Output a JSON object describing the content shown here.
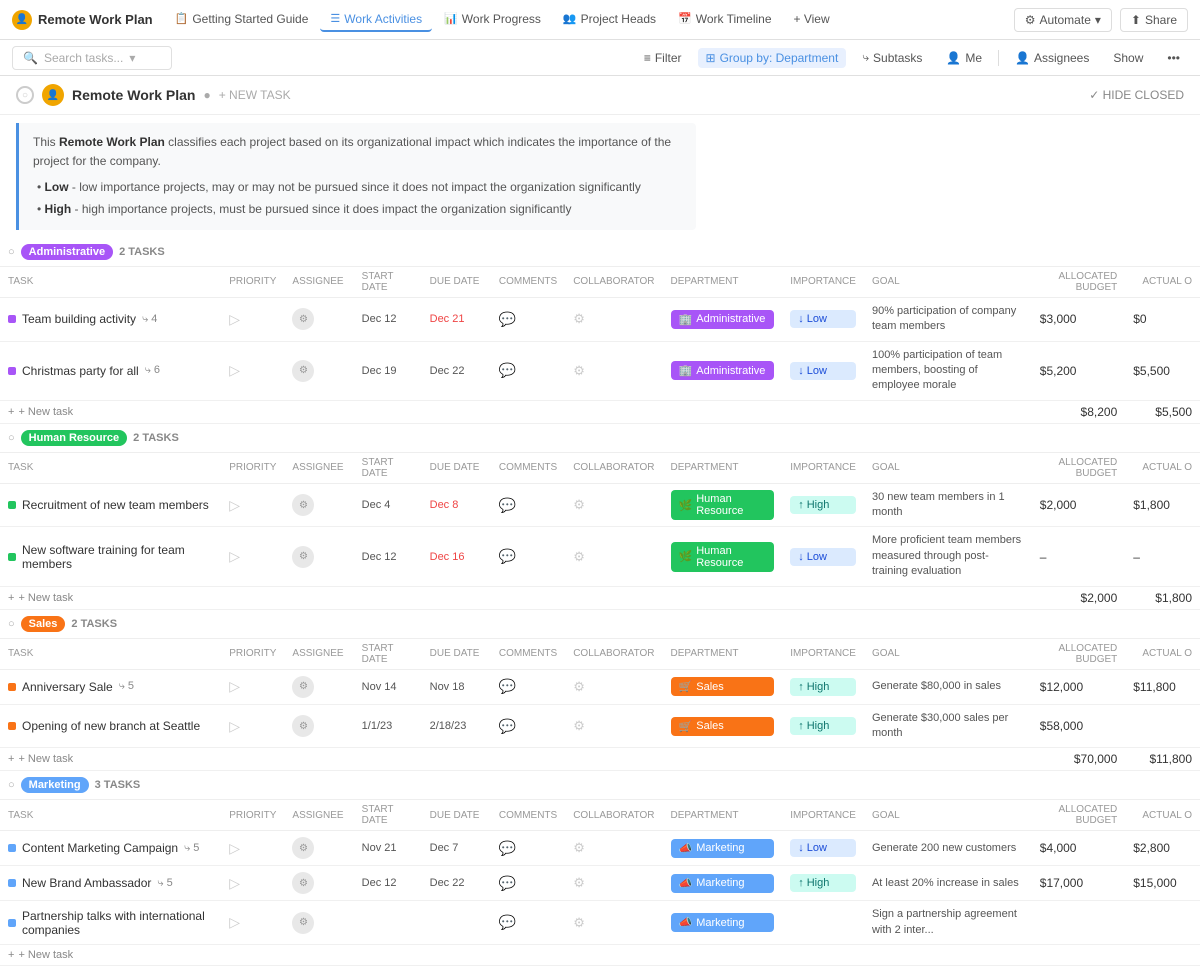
{
  "app": {
    "title": "Remote Work Plan"
  },
  "topnav": {
    "logo_text": "Remote Work Plan",
    "avatar_icon": "👤",
    "tabs": [
      {
        "id": "getting-started",
        "label": "Getting Started Guide",
        "icon": "📋",
        "active": false
      },
      {
        "id": "work-activities",
        "label": "Work Activities",
        "icon": "☰",
        "active": true
      },
      {
        "id": "work-progress",
        "label": "Work Progress",
        "icon": "📊",
        "active": false
      },
      {
        "id": "project-heads",
        "label": "Project Heads",
        "icon": "👥",
        "active": false
      },
      {
        "id": "work-timeline",
        "label": "Work Timeline",
        "icon": "📅",
        "active": false
      }
    ],
    "view_btn": "+ View",
    "automate_btn": "Automate",
    "share_btn": "Share"
  },
  "toolbar": {
    "search_placeholder": "Search tasks...",
    "filter_label": "Filter",
    "group_label": "Group by: Department",
    "subtasks_label": "Subtasks",
    "me_label": "Me",
    "assignees_label": "Assignees",
    "show_label": "Show"
  },
  "project": {
    "title": "Remote Work Plan",
    "avatar_icon": "👤",
    "new_task_label": "+ NEW TASK",
    "hide_closed_label": "✓ HIDE CLOSED",
    "info_text": "This Remote Work Plan classifies each project based on its organizational impact which indicates the importance of the project for the company.",
    "info_items": [
      "Low - low importance projects, may or may not be pursued since it does not impact the organization significantly",
      "High - high importance projects, must be pursued since it does impact the organization significantly"
    ]
  },
  "columns": {
    "task": "TASK",
    "priority": "PRIORITY",
    "assignee": "ASSIGNEE",
    "start_date": "START DATE",
    "due_date": "DUE DATE",
    "comments": "COMMENTS",
    "collaborator": "COLLABORATOR",
    "department": "DEPARTMENT",
    "importance": "IMPORTANCE",
    "goal": "GOAL",
    "allocated_budget": "ALLOCATED BUDGET",
    "actual": "ACTUAL O"
  },
  "groups": [
    {
      "id": "administrative",
      "label": "Administrative",
      "badge_class": "badge-admin",
      "dot_class": "dot-purple",
      "dept_class": "dept-admin",
      "task_count": "2 TASKS",
      "subtotal_budget": "$8,200",
      "subtotal_actual": "$5,500",
      "tasks": [
        {
          "name": "Team building activity",
          "tag": "4",
          "priority": "▷",
          "start_date": "Dec 12",
          "due_date": "Dec 21",
          "due_overdue": true,
          "department": "Administrative",
          "dept_icon": "🏢",
          "importance": "Low",
          "imp_class": "imp-low",
          "imp_arrow": "↓",
          "goal": "90% participation of company team members",
          "allocated_budget": "$3,000",
          "actual": "$0"
        },
        {
          "name": "Christmas party for all",
          "tag": "6",
          "priority": "▷",
          "start_date": "Dec 19",
          "due_date": "Dec 22",
          "due_overdue": false,
          "department": "Administrative",
          "dept_icon": "🏢",
          "importance": "Low",
          "imp_class": "imp-low",
          "imp_arrow": "↓",
          "goal": "100% participation of team members, boosting of employee morale",
          "allocated_budget": "$5,200",
          "actual": "$5,500"
        }
      ]
    },
    {
      "id": "human-resource",
      "label": "Human Resource",
      "badge_class": "badge-hr",
      "dot_class": "dot-green",
      "dept_class": "dept-hr",
      "task_count": "2 TASKS",
      "subtotal_budget": "$2,000",
      "subtotal_actual": "$1,800",
      "tasks": [
        {
          "name": "Recruitment of new team members",
          "tag": "",
          "priority": "▷",
          "start_date": "Dec 4",
          "due_date": "Dec 8",
          "due_overdue": true,
          "department": "Human Resource",
          "dept_icon": "🌿",
          "importance": "High",
          "imp_class": "imp-high",
          "imp_arrow": "↑",
          "goal": "30 new team members in 1 month",
          "allocated_budget": "$2,000",
          "actual": "$1,800"
        },
        {
          "name": "New software training for team members",
          "tag": "",
          "priority": "▷",
          "start_date": "Dec 12",
          "due_date": "Dec 16",
          "due_overdue": true,
          "department": "Human Resource",
          "dept_icon": "🌿",
          "importance": "Low",
          "imp_class": "imp-low",
          "imp_arrow": "↓",
          "goal": "More proficient team members measured through post-training evaluation",
          "allocated_budget": "–",
          "actual": "–"
        }
      ]
    },
    {
      "id": "sales",
      "label": "Sales",
      "badge_class": "badge-sales",
      "dot_class": "dot-orange",
      "dept_class": "dept-sales",
      "task_count": "2 TASKS",
      "subtotal_budget": "$70,000",
      "subtotal_actual": "$11,800",
      "tasks": [
        {
          "name": "Anniversary Sale",
          "tag": "5",
          "priority": "▷",
          "start_date": "Nov 14",
          "due_date": "Nov 18",
          "due_overdue": false,
          "department": "Sales",
          "dept_icon": "🛒",
          "importance": "High",
          "imp_class": "imp-high",
          "imp_arrow": "↑",
          "goal": "Generate $80,000 in sales",
          "allocated_budget": "$12,000",
          "actual": "$11,800"
        },
        {
          "name": "Opening of new branch at Seattle",
          "tag": "",
          "priority": "▷",
          "start_date": "1/1/23",
          "due_date": "2/18/23",
          "due_overdue": false,
          "department": "Sales",
          "dept_icon": "🛒",
          "importance": "High",
          "imp_class": "imp-high",
          "imp_arrow": "↑",
          "goal": "Generate $30,000 sales per month",
          "allocated_budget": "$58,000",
          "actual": ""
        }
      ]
    },
    {
      "id": "marketing",
      "label": "Marketing",
      "badge_class": "badge-marketing",
      "dot_class": "dot-blue",
      "dept_class": "dept-marketing",
      "task_count": "3 TASKS",
      "subtotal_budget": "",
      "subtotal_actual": "",
      "tasks": [
        {
          "name": "Content Marketing Campaign",
          "tag": "5",
          "priority": "▷",
          "start_date": "Nov 21",
          "due_date": "Dec 7",
          "due_overdue": false,
          "department": "Marketing",
          "dept_icon": "📣",
          "importance": "Low",
          "imp_class": "imp-low",
          "imp_arrow": "↓",
          "goal": "Generate 200 new customers",
          "allocated_budget": "$4,000",
          "actual": "$2,800"
        },
        {
          "name": "New Brand Ambassador",
          "tag": "5",
          "priority": "▷",
          "start_date": "Dec 12",
          "due_date": "Dec 22",
          "due_overdue": false,
          "department": "Marketing",
          "dept_icon": "📣",
          "importance": "High",
          "imp_class": "imp-high",
          "imp_arrow": "↑",
          "goal": "At least 20% increase in sales",
          "allocated_budget": "$17,000",
          "actual": "$15,000"
        },
        {
          "name": "Partnership talks with international companies",
          "tag": "",
          "priority": "▷",
          "start_date": "",
          "due_date": "",
          "due_overdue": false,
          "department": "Marketing",
          "dept_icon": "📣",
          "importance": "",
          "imp_class": "",
          "imp_arrow": "",
          "goal": "Sign a partnership agreement with 2 inter...",
          "allocated_budget": "",
          "actual": ""
        }
      ]
    }
  ],
  "new_task_label": "+ New task"
}
